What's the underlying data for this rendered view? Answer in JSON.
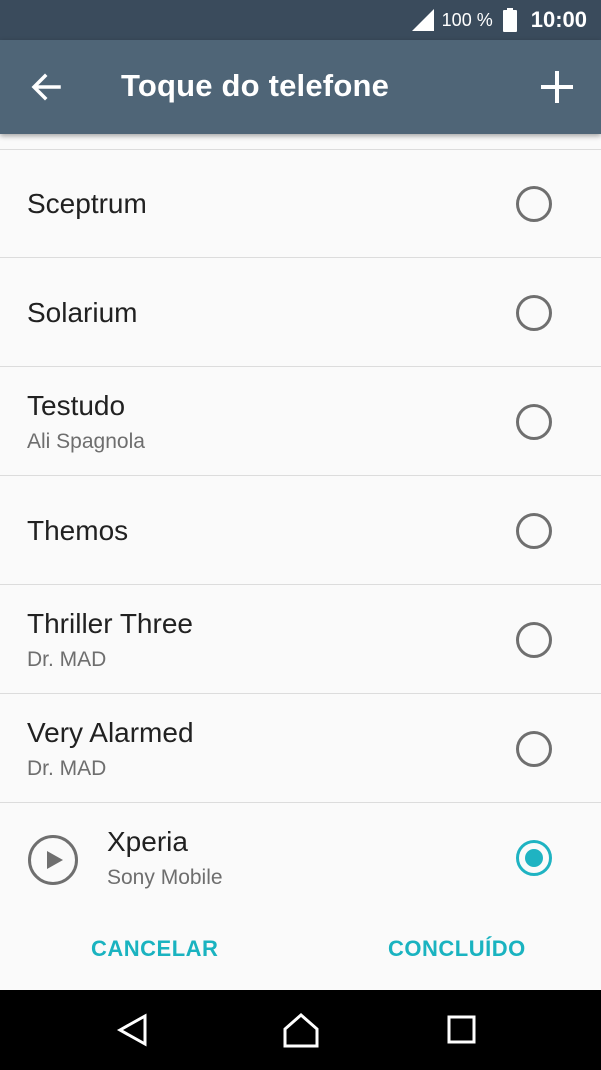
{
  "status_bar": {
    "battery_percent": "100 %",
    "time": "10:00",
    "icons": [
      "signal-icon",
      "battery-icon"
    ]
  },
  "app_bar": {
    "title": "Toque do telefone",
    "icons": [
      "back-arrow-icon",
      "add-icon"
    ]
  },
  "ringtones": [
    {
      "name": "Sceptrum",
      "artist": "",
      "selected": false
    },
    {
      "name": "Solarium",
      "artist": "",
      "selected": false
    },
    {
      "name": "Testudo",
      "artist": "Ali Spagnola",
      "selected": false
    },
    {
      "name": "Themos",
      "artist": "",
      "selected": false
    },
    {
      "name": "Thriller Three",
      "artist": "Dr. MAD",
      "selected": false
    },
    {
      "name": "Very Alarmed",
      "artist": "Dr. MAD",
      "selected": false
    },
    {
      "name": "Xperia",
      "artist": "Sony Mobile",
      "selected": true
    }
  ],
  "actions": {
    "cancel_label": "CANCELAR",
    "done_label": "CONCLUÍDO"
  },
  "colors": {
    "status_bar": "#3a4b5c",
    "app_bar": "#4f6577",
    "accent": "#1fb3c2",
    "nav_bar": "#000000"
  },
  "nav_bar": {
    "icons": [
      "nav-back-icon",
      "nav-home-icon",
      "nav-recents-icon"
    ]
  }
}
